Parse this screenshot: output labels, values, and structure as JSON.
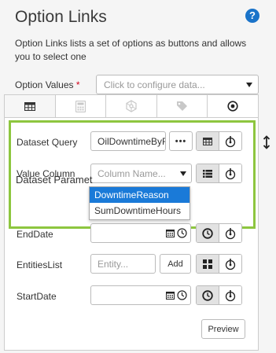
{
  "header": {
    "title": "Option Links",
    "help_glyph": "?"
  },
  "description": "Option Links lists a set of options as buttons and allows you to select one",
  "option_values": {
    "label": "Option Values",
    "required_mark": "*",
    "placeholder": "Click to configure data..."
  },
  "tabs": [
    {
      "icon": "table-icon",
      "active": true
    },
    {
      "icon": "calculator-icon",
      "active": false
    },
    {
      "icon": "network-icon",
      "active": false
    },
    {
      "icon": "tag-icon",
      "active": false
    },
    {
      "icon": "target-icon",
      "active": false
    }
  ],
  "form": {
    "dataset_query": {
      "label": "Dataset Query",
      "value": "OilDowntimeByF",
      "more_label": "•••"
    },
    "value_column": {
      "label": "Value Column",
      "placeholder": "Column Name...",
      "options": [
        "DowntimeReason",
        "SumDowntimeHours"
      ],
      "highlighted": "DowntimeReason"
    },
    "dataset_parameters_title": "Dataset Paramet",
    "end_date": {
      "label": "EndDate"
    },
    "entities_list": {
      "label": "EntitiesList",
      "placeholder": "Entity...",
      "add_label": "Add"
    },
    "start_date": {
      "label": "StartDate"
    },
    "preview_label": "Preview"
  },
  "colors": {
    "accent_green": "#8dc63f",
    "selection_blue": "#1a7ad8",
    "help_blue": "#1a73c9",
    "required_red": "#d0021b"
  }
}
